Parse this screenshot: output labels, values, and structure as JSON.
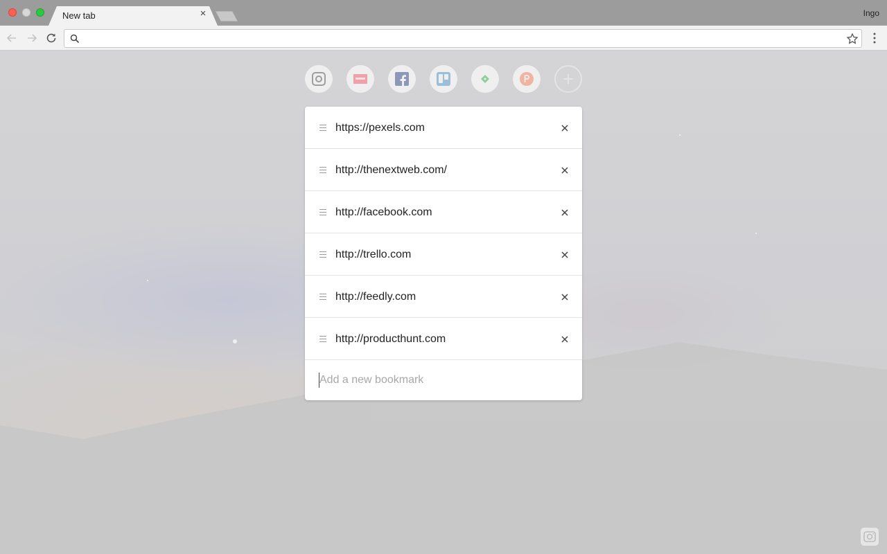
{
  "browser": {
    "tab_title": "New tab",
    "profile_name": "Ingo",
    "omnibox_value": "",
    "omnibox_placeholder": ""
  },
  "speed_dial": [
    {
      "name": "instagram",
      "icon": "instagram-icon",
      "color": "#9e9e9e"
    },
    {
      "name": "thenextweb",
      "icon": "tnw-icon",
      "color": "#f0a0a8"
    },
    {
      "name": "facebook",
      "icon": "facebook-icon",
      "color": "#8c98b8"
    },
    {
      "name": "trello",
      "icon": "trello-icon",
      "color": "#9bbfd9"
    },
    {
      "name": "feedly",
      "icon": "feedly-icon",
      "color": "#8fcf9a"
    },
    {
      "name": "producthunt",
      "icon": "producthunt-icon",
      "color": "#f0b4a0"
    },
    {
      "name": "add",
      "icon": "plus-icon",
      "color": "#e4e4e4"
    }
  ],
  "bookmarks": [
    {
      "url": "https://pexels.com"
    },
    {
      "url": "http://thenextweb.com/"
    },
    {
      "url": "http://facebook.com"
    },
    {
      "url": "http://trello.com"
    },
    {
      "url": "http://feedly.com"
    },
    {
      "url": "http://producthunt.com"
    }
  ],
  "add_bookmark": {
    "value": "",
    "placeholder": "Add a new bookmark"
  }
}
